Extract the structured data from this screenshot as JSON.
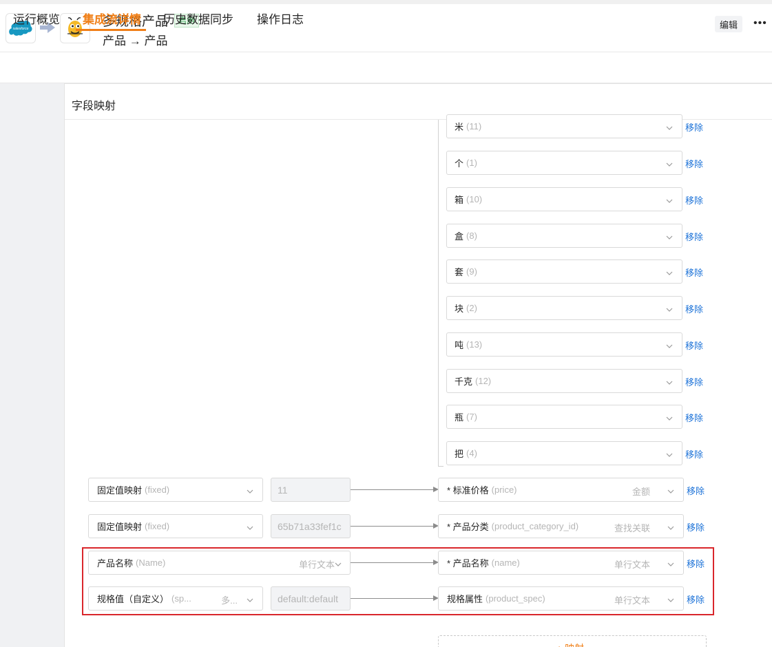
{
  "header": {
    "title": "多规格产品",
    "status": "启用",
    "subtitle": "产品 → 产品",
    "source_logo": "salesforce",
    "target_logo": "bee-mascot",
    "edit_label": "编辑",
    "more_icon": "more-horizontal-icon"
  },
  "tabs": [
    {
      "label": "运行概览"
    },
    {
      "label": "集成流详情",
      "active": true
    },
    {
      "label": "历史数据同步"
    },
    {
      "label": "操作日志"
    }
  ],
  "panel": {
    "title": "字段映射"
  },
  "option_rows": [
    {
      "name": "米",
      "value": "(11)",
      "remove": "移除"
    },
    {
      "name": "个",
      "value": "(1)",
      "remove": "移除"
    },
    {
      "name": "箱",
      "value": "(10)",
      "remove": "移除"
    },
    {
      "name": "盒",
      "value": "(8)",
      "remove": "移除"
    },
    {
      "name": "套",
      "value": "(9)",
      "remove": "移除"
    },
    {
      "name": "块",
      "value": "(2)",
      "remove": "移除"
    },
    {
      "name": "吨",
      "value": "(13)",
      "remove": "移除"
    },
    {
      "name": "千克",
      "value": "(12)",
      "remove": "移除"
    },
    {
      "name": "瓶",
      "value": "(7)",
      "remove": "移除"
    },
    {
      "name": "把",
      "value": "(4)",
      "remove": "移除"
    }
  ],
  "mappings": [
    {
      "source_name": "固定值映射",
      "source_api": "(fixed)",
      "source_type": "",
      "value": "11",
      "target_name": "* 标准价格",
      "target_api": "(price)",
      "target_type": "金额",
      "remove": "移除"
    },
    {
      "source_name": "固定值映射",
      "source_api": "(fixed)",
      "source_type": "",
      "value": "65b71a33fef1c",
      "target_name": "* 产品分类",
      "target_api": "(product_category_id)",
      "target_type": "查找关联",
      "remove": "移除"
    },
    {
      "source_name": "产品名称",
      "source_api": "(Name)",
      "source_type": "单行文本",
      "value": "",
      "target_name": "* 产品名称",
      "target_api": "(name)",
      "target_type": "单行文本",
      "remove": "移除"
    },
    {
      "source_name": "规格值（自定义）",
      "source_api": "(sp...",
      "source_type": "多...",
      "value": "default:default",
      "target_name": "规格属性",
      "target_api": "(product_spec)",
      "target_type": "单行文本",
      "remove": "移除"
    }
  ],
  "add_mapping_label": "+ 映射",
  "colors": {
    "accent": "#f07f17",
    "link": "#1e73d8",
    "status_green": "#3aa655",
    "highlight_red": "#d9262b"
  }
}
